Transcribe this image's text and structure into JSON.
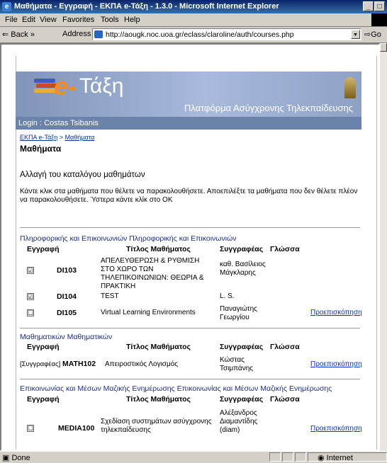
{
  "window": {
    "title": "Μαθήματα - Εγγραφή - ΕΚΠΑ e-Τάξη - 1.3.0 - Microsoft Internet Explorer"
  },
  "menu": [
    "File",
    "Edit",
    "View",
    "Favorites",
    "Tools",
    "Help"
  ],
  "toolbar": {
    "back": "Back",
    "more": "»",
    "address_label": "Address",
    "url": "http://aougk.noc.uoa.gr/eclass/claroline/auth/courses.php",
    "go": "Go"
  },
  "banner": {
    "logo_e": "e-",
    "logo_taxi": "Τάξη",
    "platform": "Πλατφόρμα Ασύγχρονης Τηλεκπαίδευσης"
  },
  "login": "Login : Costas Tsibanis",
  "breadcrumb": {
    "home": "ΕΚΠΑ e-Τάξη",
    "sep": ">",
    "current": "Μαθήματα"
  },
  "page_title": "Μαθήματα",
  "change_label": "Αλλαγή του καταλόγου μαθημάτων",
  "instructions": "Κάντε κλικ στα μαθήματα που θέλετε να παρακολουθήσετε. Αποεπιλέξτε τα μαθήματα που δεν θέλετε πλέον να παρακολουθήσετε. Ύστερα κάντε κλίκ στο ΟΚ",
  "columns": {
    "enroll": "Εγγραφή",
    "title": "Τίτλος Μαθήματος",
    "author": "Συγγραφέας",
    "lang": "Γλώσσα"
  },
  "preview_label": "Προεπισκόπηση",
  "sections": [
    {
      "name": "Πληροφορικής και Επικοινωνιών Πληροφορικής και Επικοινωνιών",
      "rows": [
        {
          "check": "☑",
          "code": "DI103",
          "title": "ΑΠΕΛΕΥΘΕΡΩΣΗ & ΡΥΘΜΙΣΗ ΣΤΟ ΧΩΡΟ ΤΩΝ ΤΗΛΕΠΙΚΟΙΝΩΝΙΩΝ: ΘΕΩΡΙΑ & ΠΡΑΚΤΙΚΗ",
          "author": "καθ. Βασίλειος Μάγκλαρης"
        },
        {
          "check": "☑",
          "code": "DI104",
          "title": "TEST",
          "author": "L. S."
        },
        {
          "check": "☐",
          "code": "DI105",
          "title": "Virtual Learning Environments",
          "author": "Παναγιώτης Γεωργίου",
          "preview": true
        }
      ]
    },
    {
      "name": "Μαθηματικών Μαθηματικών",
      "rows": [
        {
          "check": "[Συγγραφέας]",
          "code": "MATH102",
          "title": "Απειροστικός Λογισμός",
          "author": "Κώστας Τσιμπάνης",
          "preview": true
        }
      ]
    },
    {
      "name": "Επικοινωνίας και Μέσων Μαζικής Ενημέρωσης Επικοινωνίας και Μέσων Μαζικής Ενημέρωσης",
      "rows": [
        {
          "check": "☐",
          "code": "MEDIA100",
          "title": "Σχεδίαση συστημάτων ασύγχρονης τηλεκπαίδευσης",
          "author": "Αλέξανδρος Διαμαντίδης (diam)",
          "preview": true
        }
      ]
    }
  ],
  "status": {
    "done": "Done",
    "zone": "Internet"
  }
}
